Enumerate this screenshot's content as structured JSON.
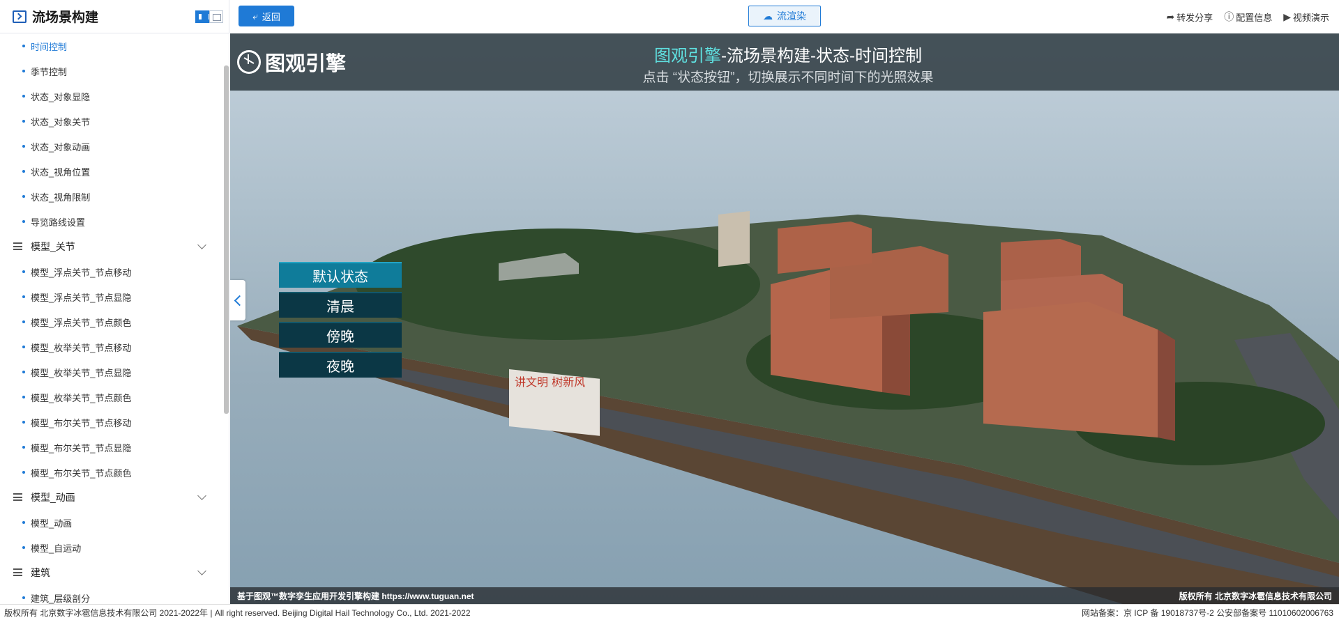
{
  "sidebar": {
    "title": "流场景构建",
    "sections": [
      {
        "type": "item",
        "label": "时间控制",
        "active": true
      },
      {
        "type": "item",
        "label": "季节控制"
      },
      {
        "type": "item",
        "label": "状态_对象显隐"
      },
      {
        "type": "item",
        "label": "状态_对象关节"
      },
      {
        "type": "item",
        "label": "状态_对象动画"
      },
      {
        "type": "item",
        "label": "状态_视角位置"
      },
      {
        "type": "item",
        "label": "状态_视角限制"
      },
      {
        "type": "item",
        "label": "导览路线设置"
      },
      {
        "type": "group",
        "label": "模型_关节"
      },
      {
        "type": "item",
        "label": "模型_浮点关节_节点移动"
      },
      {
        "type": "item",
        "label": "模型_浮点关节_节点显隐"
      },
      {
        "type": "item",
        "label": "模型_浮点关节_节点颜色"
      },
      {
        "type": "item",
        "label": "模型_枚举关节_节点移动"
      },
      {
        "type": "item",
        "label": "模型_枚举关节_节点显隐"
      },
      {
        "type": "item",
        "label": "模型_枚举关节_节点颜色"
      },
      {
        "type": "item",
        "label": "模型_布尔关节_节点移动"
      },
      {
        "type": "item",
        "label": "模型_布尔关节_节点显隐"
      },
      {
        "type": "item",
        "label": "模型_布尔关节_节点颜色"
      },
      {
        "type": "group",
        "label": "模型_动画"
      },
      {
        "type": "item",
        "label": "模型_动画"
      },
      {
        "type": "item",
        "label": "模型_自运动"
      },
      {
        "type": "group",
        "label": "建筑"
      },
      {
        "type": "item",
        "label": "建筑_层级剖分"
      }
    ]
  },
  "toolbar": {
    "back_label": "返回",
    "render_label": "流渲染",
    "share_label": "转发分享",
    "config_label": "配置信息",
    "video_label": "视频演示"
  },
  "viewport": {
    "logo_text": "图观引擎",
    "title_accent": "图观引擎",
    "title_rest": "-流场景构建-状态-时间控制",
    "subtitle": "点击 “状态按钮”，切换展示不同时间下的光照效果",
    "state_buttons": [
      "默认状态",
      "清晨",
      "傍晚",
      "夜晚"
    ],
    "billboard_text": "讲文明 树新风",
    "footer_left": "基于图观™数字孪生应用开发引擎构建 https://www.tuguan.net",
    "footer_right": "版权所有 北京数字冰雹信息技术有限公司"
  },
  "bottom_bar": {
    "copyright": "版权所有 北京数字冰雹信息技术有限公司 2021-2022年 | All right reserved. Beijing Digital Hail Technology Co., Ltd. 2021-2022",
    "icp": "网站备案：京 ICP 备 19018737号-2 公安部备案号 11010602006763"
  },
  "colors": {
    "accent": "#1f7ad6",
    "title_accent": "#5fe0e0",
    "state_active": "#0f7c9a",
    "state_default": "#0b3745"
  }
}
